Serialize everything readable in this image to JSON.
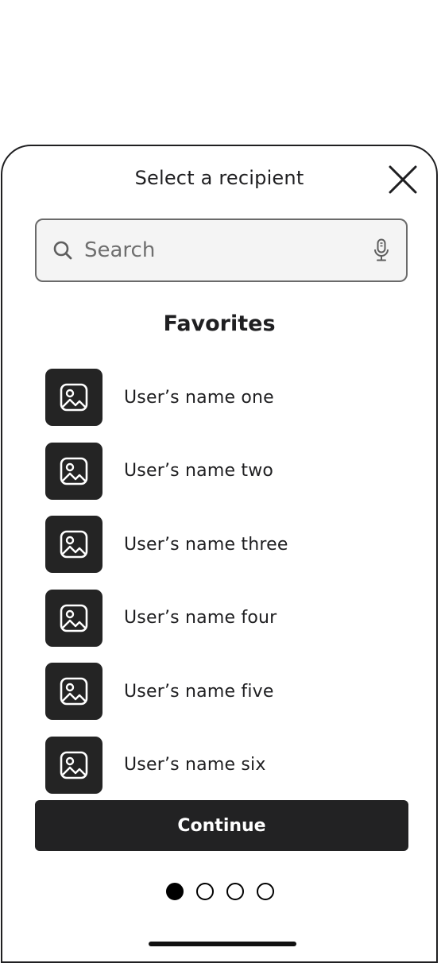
{
  "sheet": {
    "title": "Select a recipient",
    "close_icon": "close-icon"
  },
  "search": {
    "placeholder": "Search",
    "value": "",
    "leading_icon": "search-icon",
    "trailing_icon": "microphone-icon"
  },
  "favorites": {
    "title": "Favorites",
    "items": [
      {
        "name": "User’s name one",
        "avatar_icon": "image-placeholder-icon"
      },
      {
        "name": "User’s name two",
        "avatar_icon": "image-placeholder-icon"
      },
      {
        "name": "User’s name three",
        "avatar_icon": "image-placeholder-icon"
      },
      {
        "name": "User’s name four",
        "avatar_icon": "image-placeholder-icon"
      },
      {
        "name": "User’s name five",
        "avatar_icon": "image-placeholder-icon"
      },
      {
        "name": "User’s name six",
        "avatar_icon": "image-placeholder-icon"
      }
    ]
  },
  "footer": {
    "continue_label": "Continue",
    "pagination": {
      "total": 4,
      "current": 1
    }
  },
  "colors": {
    "primary_dark": "#222223",
    "search_bg": "#f4f4f4",
    "search_border": "#6a6a6a",
    "text": "#1f1f21"
  }
}
